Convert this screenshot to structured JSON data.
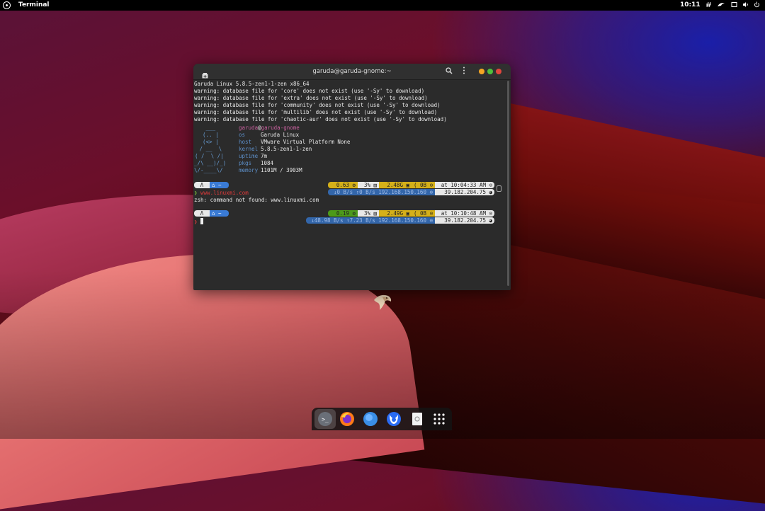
{
  "topbar": {
    "app_name": "Terminal",
    "clock": "10:11",
    "tray_icons": [
      "network-icon",
      "garuda-eagle-icon",
      "window-icon",
      "speaker-icon",
      "power-icon"
    ]
  },
  "terminal": {
    "title": "garuda@garuda-gnome:~",
    "lines": [
      "Garuda Linux 5.8.5-zen1-1-zen x86_64",
      "warning: database file for 'core' does not exist (use '-Sy' to download)",
      "warning: database file for 'extra' does not exist (use '-Sy' to download)",
      "warning: database file for 'community' does not exist (use '-Sy' to download)",
      "warning: database file for 'multilib' does not exist (use '-Sy' to download)",
      "warning: database file for 'chaotic-aur' does not exist (use '-Sy' to download)"
    ],
    "neofetch": {
      "ascii": [
        "   ___",
        "  (.. |",
        "  (<> |",
        " / __  \\",
        "( /  \\ /|",
        "_/\\ __)/_)",
        "\\/-____\\/"
      ],
      "user": "garuda",
      "at": "@",
      "host": "garuda-gnome",
      "fields": [
        {
          "key": "os",
          "value": "Garuda Linux"
        },
        {
          "key": "host",
          "value": "VMware Virtual Platform None"
        },
        {
          "key": "kernel",
          "value": "5.8.5-zen1-1-zen"
        },
        {
          "key": "uptime",
          "value": "7m"
        },
        {
          "key": "pkgs",
          "value": "1084"
        },
        {
          "key": "memory",
          "value": "1101M / 3903M"
        }
      ]
    },
    "prompt1": {
      "user_seg": "Λ",
      "dir_seg": "⌂ ~",
      "load": "0.63 ⚙",
      "cpu": "3% ▤",
      "mem": "2.48G ▣",
      "disk": "( 0B ⊙",
      "time": "at 10:04:33 AM ⊙",
      "net": "↓0 B/s ↑0 B/s 192.168.150.160 ⊕",
      "ip": "39.182.204.75 ◕",
      "command": "www.linuxmi.com",
      "output": "zsh: command not found: www.linuxmi.com"
    },
    "prompt2": {
      "user_seg": "Λ",
      "dir_seg": "⌂ ~",
      "load": "0.19 ⚙",
      "cpu": "3% ▤",
      "mem": "2.49G ▣",
      "disk": "( 0B ⊙",
      "time": "at 10:10:48 AM ⊙",
      "net": "↓48.98 B/s ↑7.23 B/s 192.168.150.160 ⊕",
      "ip": "39.182.204.75 ◕"
    }
  },
  "dock": {
    "items": [
      "terminal-icon",
      "firefox-icon",
      "files-icon",
      "browser-icon",
      "trash-icon",
      "app-grid-icon"
    ]
  },
  "colors": {
    "close": "#e2463d",
    "maximize": "#4fbf3c",
    "minimize": "#f5a623"
  }
}
